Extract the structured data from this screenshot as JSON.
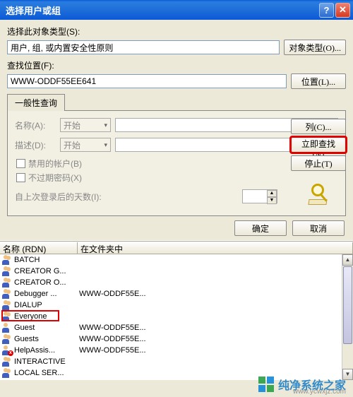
{
  "titlebar": {
    "title": "选择用户或组"
  },
  "section1": {
    "label": "选择此对象类型(S):",
    "value": "用户, 组, 或内置安全性原则",
    "button": "对象类型(O)..."
  },
  "section2": {
    "label": "查找位置(F):",
    "value": "WWW-ODDF55EE641",
    "button": "位置(L)..."
  },
  "tab": {
    "label": "一般性查询"
  },
  "query": {
    "name_label": "名称(A):",
    "name_mode": "开始",
    "desc_label": "描述(D):",
    "desc_mode": "开始",
    "chk_disabled": "禁用的帐户(B)",
    "chk_noexpire": "不过期密码(X)",
    "days_label": "自上次登录后的天数(I):"
  },
  "side": {
    "columns": "列(C)...",
    "findnow": "立即查找(N)",
    "stop": "停止(T)"
  },
  "footer": {
    "ok": "确定",
    "cancel": "取消"
  },
  "results_header": {
    "name": "名称 (RDN)",
    "folder": "在文件夹中"
  },
  "results": [
    {
      "name": "BATCH",
      "folder": "",
      "group": true
    },
    {
      "name": "CREATOR G...",
      "folder": "",
      "group": true
    },
    {
      "name": "CREATOR O...",
      "folder": "",
      "group": true
    },
    {
      "name": "Debugger ...",
      "folder": "WWW-ODDF55E...",
      "group": true
    },
    {
      "name": "DIALUP",
      "folder": "",
      "group": true
    },
    {
      "name": "Everyone",
      "folder": "",
      "group": true,
      "highlight": true
    },
    {
      "name": "Guest",
      "folder": "WWW-ODDF55E...",
      "group": false
    },
    {
      "name": "Guests",
      "folder": "WWW-ODDF55E...",
      "group": true
    },
    {
      "name": "HelpAssis...",
      "folder": "WWW-ODDF55E...",
      "group": false,
      "error": true
    },
    {
      "name": "INTERACTIVE",
      "folder": "",
      "group": true
    },
    {
      "name": "LOCAL SER...",
      "folder": "",
      "group": true
    }
  ],
  "watermark": {
    "text": "纯净系统之家",
    "url": "www.ycwxjz.com"
  }
}
